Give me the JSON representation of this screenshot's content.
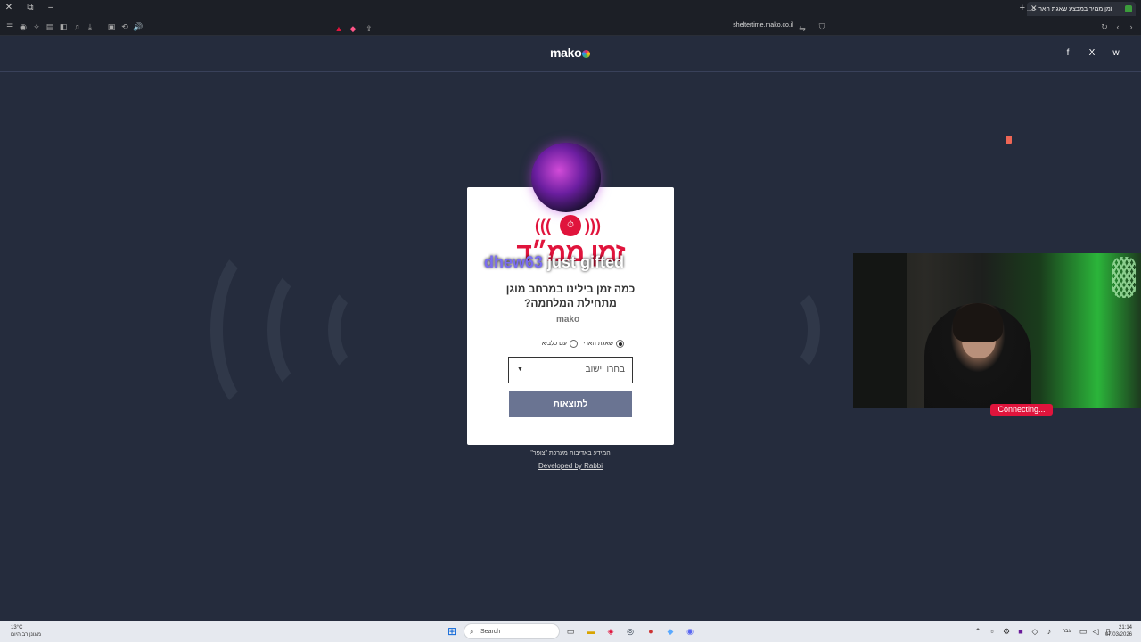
{
  "browser": {
    "tab_title": "זמן ממיר במבצע שאגת הארי כ...",
    "url_host": "sheltertime.mako.co.il"
  },
  "header": {
    "logo": "mako",
    "social": [
      "f",
      "X",
      "w"
    ]
  },
  "card": {
    "title": "זמן ממ״ד",
    "question_line1": "כמה זמן בילינו במרחב מוגן",
    "question_line2": "מתחילת המלחמה?",
    "mini_logo": "mako",
    "radio_1": "שאגת הארי",
    "radio_2": "עם כלביא",
    "select_placeholder": "בחרו יישוב",
    "submit": "לתוצאות",
    "credit": "המידע באדיבות מערכת \"צופר\"",
    "developer": "Developed by Rabbi"
  },
  "overlay": {
    "gift_user": "dhew63",
    "gift_text": " just gifted",
    "cam_status": "Connecting..."
  },
  "taskbar": {
    "weather_temp": "13°C",
    "weather_desc": "מעונן רב היום",
    "search": "Search",
    "time": "21:14",
    "date": "07/03/2026",
    "lang": "עבר"
  }
}
